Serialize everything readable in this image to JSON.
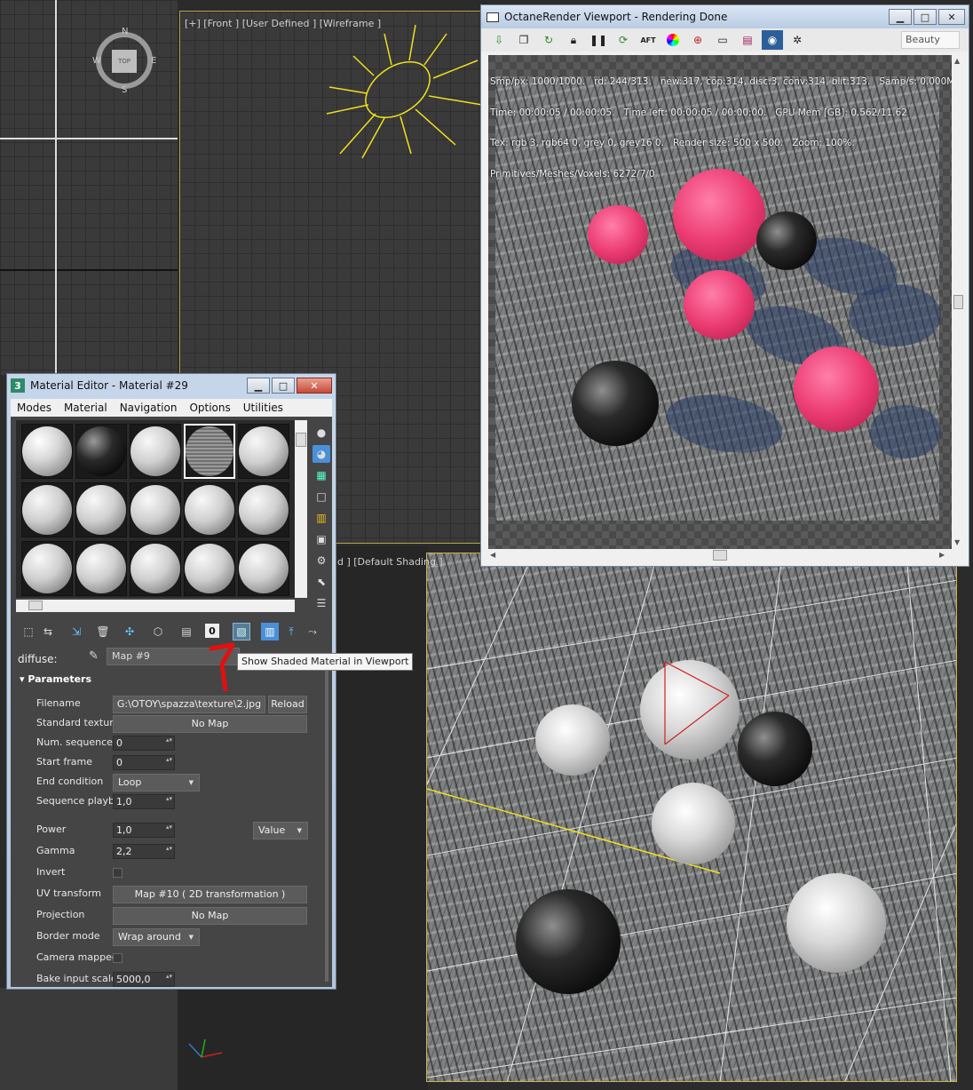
{
  "front_viewport": {
    "label": "[+] [Front ] [User Defined ] [Wireframe ]"
  },
  "viewcube": {
    "top": "TOP",
    "n": "N",
    "s": "S",
    "e": "E",
    "w": "W"
  },
  "perspective_viewport": {
    "label": "d ] [Default Shading ]"
  },
  "octane": {
    "title": "OctaneRender Viewport - Rendering Done",
    "window_buttons": {
      "minimize": "▁",
      "maximize": "□",
      "close": "✕"
    },
    "toolbar_icons": [
      "export-icon",
      "copy-icon",
      "refresh-icon",
      "lock-icon",
      "pause-icon",
      "restart-icon",
      "aft-icon",
      "color-wheel-icon",
      "target-icon",
      "monitor-icon",
      "film-icon",
      "camera-icon",
      "gear-icon"
    ],
    "aft_label": "AFT",
    "pass_select": "Beauty",
    "stats": [
      "Smp/px: 1000/1000.   rd: 244/313.   new:317, cop:314, disc:3, conv:314, blit:313.   Samp/s: 0.000M.",
      "Time: 00:00:05 / 00:00:05.   Time left: 00:00:05 / 00:00:00.   GPU Mem [GB]: 0.562/11.62",
      "Tex: rgb 3, rgb64 0, grey 0, grey16 0.   Render size: 500 x 500.   Zoom: 100%.",
      "Primitives/Meshes/Voxels: 6272/7/0"
    ]
  },
  "material_editor": {
    "title": "Material Editor - Material #29",
    "title_icon": "3",
    "window_buttons": {
      "minimize": "▁",
      "maximize": "□",
      "close": "✕"
    },
    "menu": [
      "Modes",
      "Material",
      "Navigation",
      "Options",
      "Utilities"
    ],
    "diffuse_label": "diffuse:",
    "map_name": "Map #9",
    "tooltip": "Show Shaded Material in Viewport",
    "rollout_title": "Parameters",
    "params": {
      "filename_label": "Filename",
      "filename_value": "G:\\OTOY\\spazza\\texture\\2.jpg",
      "reload": "Reload",
      "standard_texture_label": "Standard texture",
      "standard_texture_value": "No Map",
      "num_sequence_label": "Num. sequence ...",
      "num_sequence_value": "0",
      "start_frame_label": "Start frame",
      "start_frame_value": "0",
      "end_condition_label": "End condition",
      "end_condition_value": "Loop",
      "sequence_playback_label": "Sequence playb...",
      "sequence_playback_value": "1,0",
      "power_label": "Power",
      "power_value": "1,0",
      "power_mode": "Value",
      "gamma_label": "Gamma",
      "gamma_value": "2,2",
      "invert_label": "Invert",
      "uv_transform_label": "UV transform",
      "uv_transform_value": "Map #10  ( 2D transformation )",
      "projection_label": "Projection",
      "projection_value": "No Map",
      "border_mode_label": "Border mode",
      "border_mode_value": "Wrap around",
      "camera_mapped_label": "Camera mapped",
      "bake_input_scale_label": "Bake input scale",
      "bake_input_scale_value": "5000,0"
    },
    "toolbar_zero": "0"
  },
  "colors": {
    "accent": "#4a90d9",
    "annotation_red": "#e01010",
    "sun_yellow": "#f0e020",
    "pink": "#ec3c74"
  }
}
